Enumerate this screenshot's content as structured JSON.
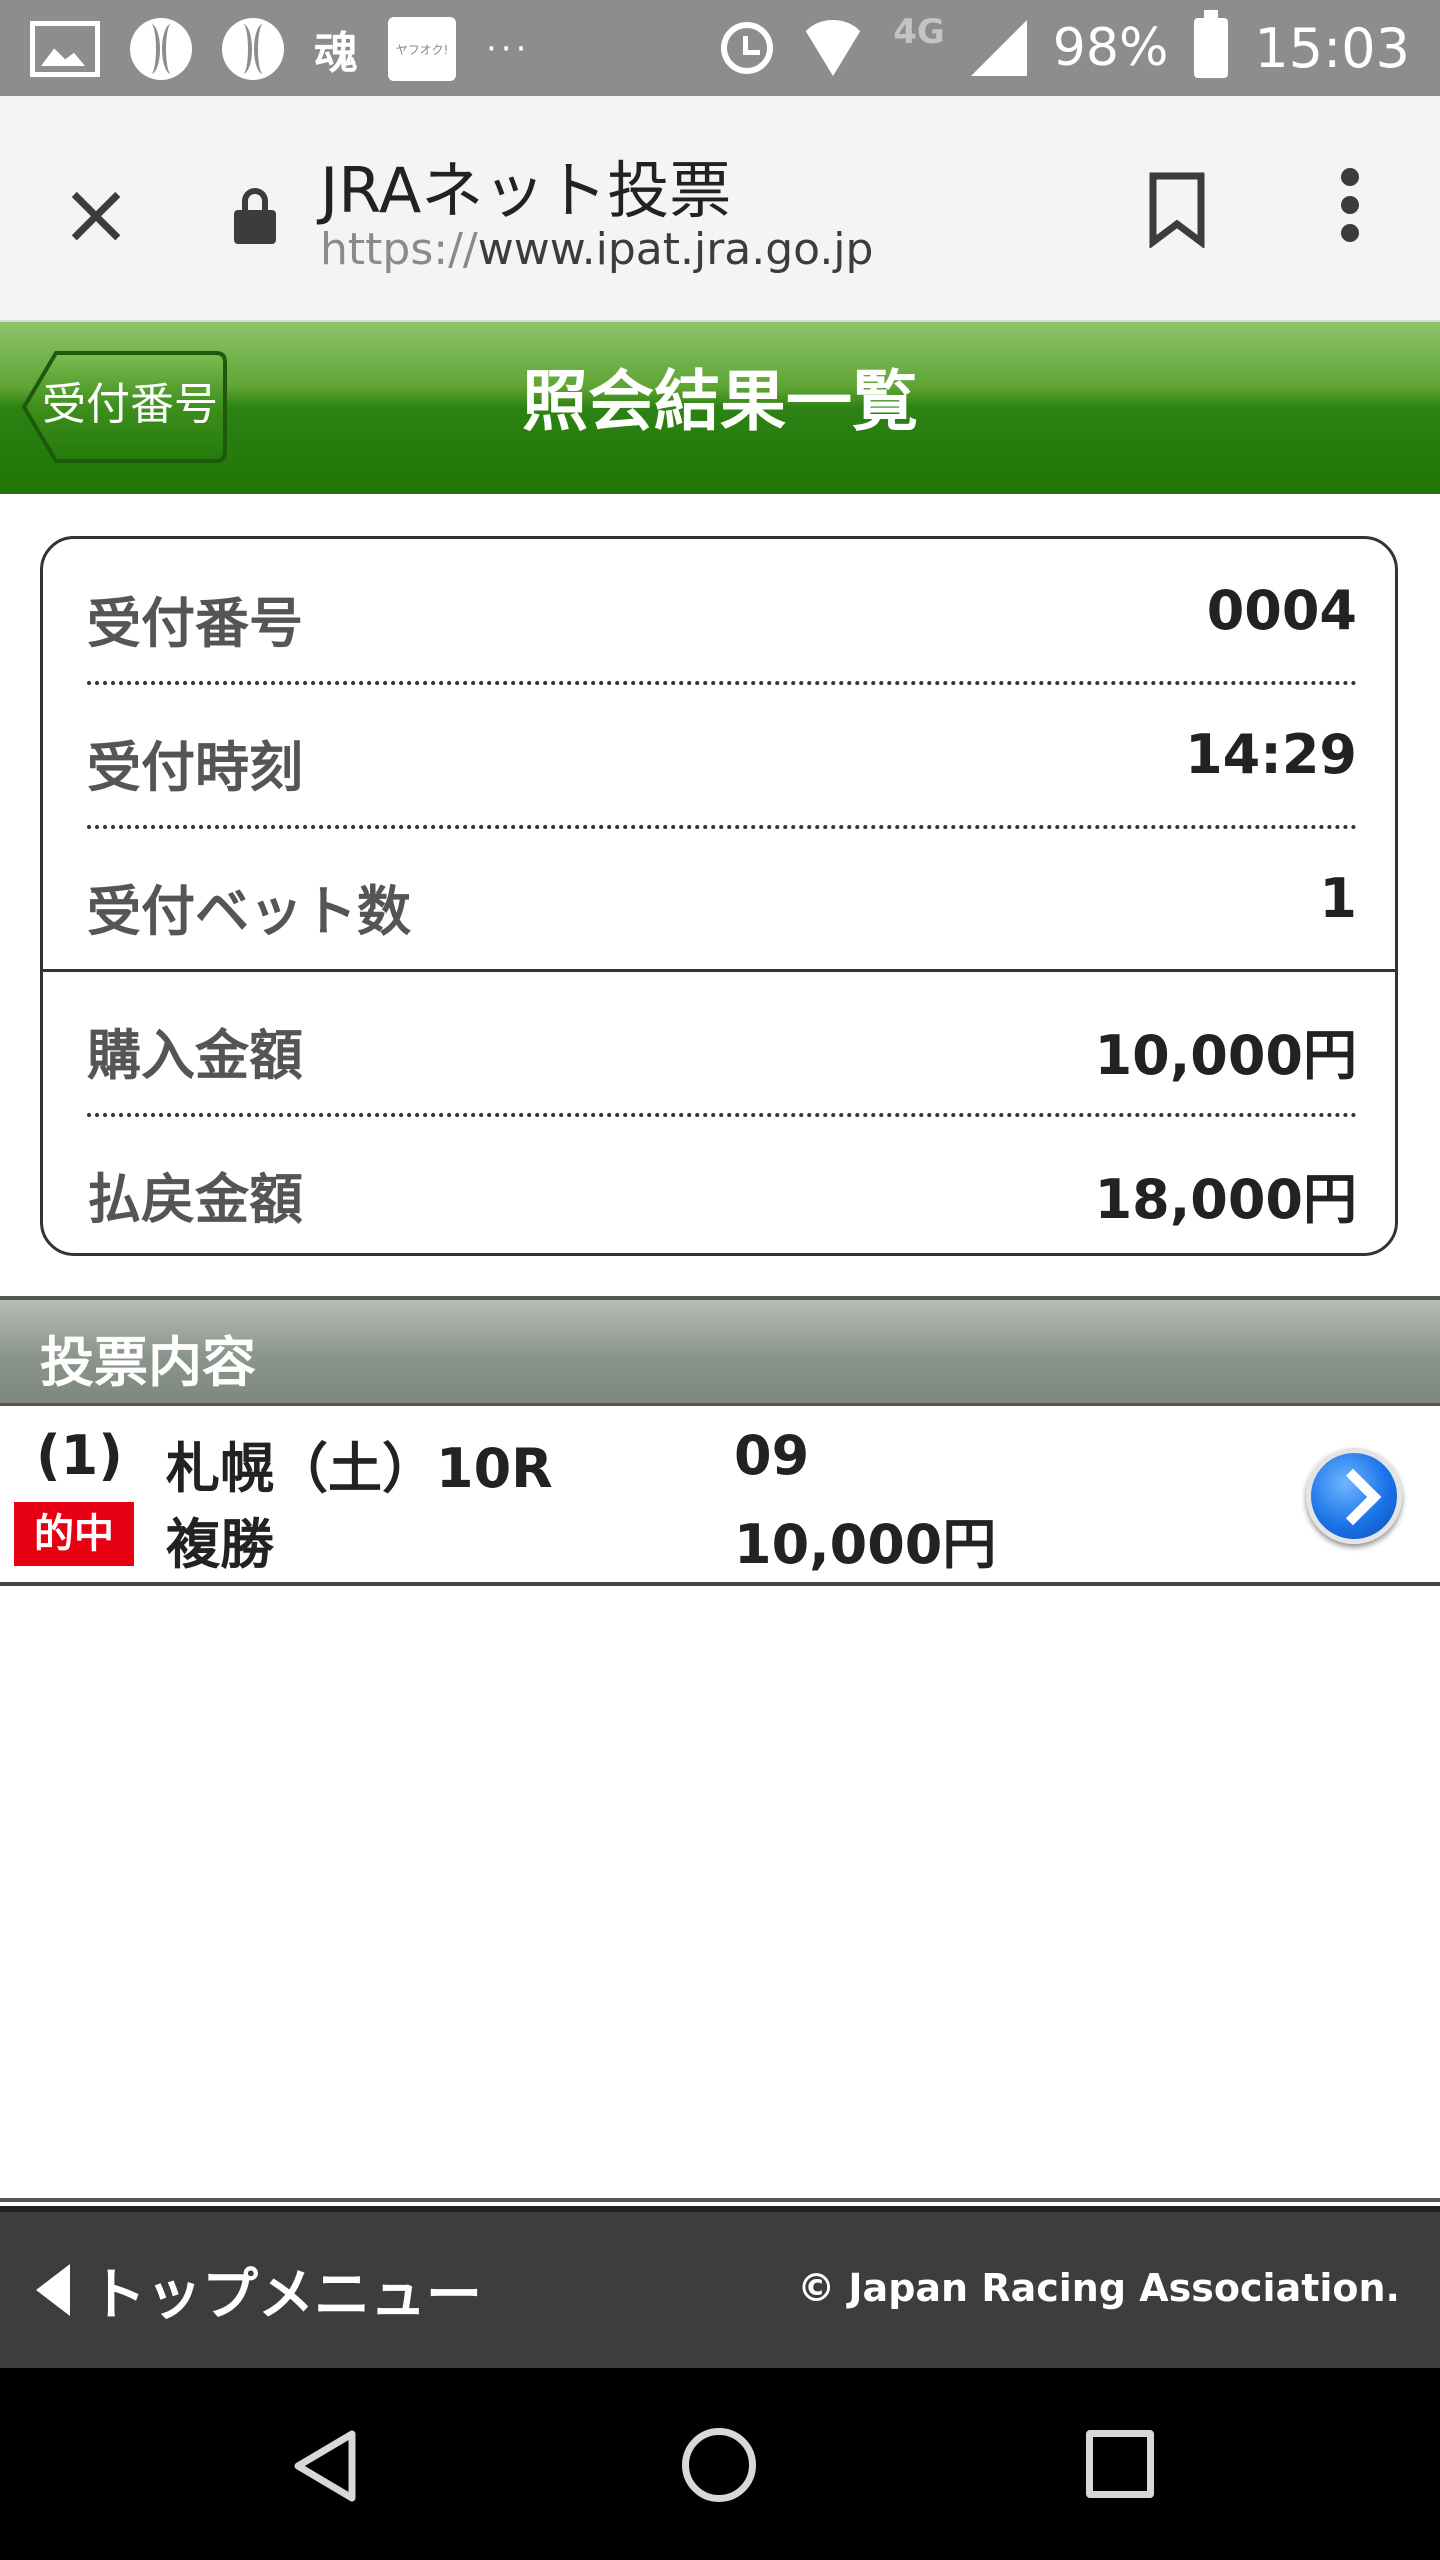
{
  "status_bar": {
    "battery_percent": "98%",
    "time": "15:03",
    "network": "4G",
    "more_dots": "···",
    "notification_icons": [
      "gallery-icon",
      "baseball-icon",
      "baseball-icon",
      "brush-app-icon",
      "yahuoku-app-icon"
    ],
    "app_label_yahuoku": "ヤフオク!"
  },
  "browser": {
    "page_title": "JRAネット投票",
    "url_scheme": "https://",
    "url_host": "www.ipat.jra.go.jp"
  },
  "header": {
    "back_label": "受付番号",
    "title": "照会結果一覧"
  },
  "summary": [
    {
      "label": "受付番号",
      "value": "0004"
    },
    {
      "label": "受付時刻",
      "value": "14:29"
    },
    {
      "label": "受付ベット数",
      "value": "1"
    },
    {
      "label": "購入金額",
      "value": "10,000円"
    },
    {
      "label": "払戻金額",
      "value": "18,000円"
    }
  ],
  "vote_section": {
    "title": "投票内容",
    "bets": [
      {
        "number": "(1)",
        "race": "札幌（土）10R",
        "horse": "09",
        "result_badge": "的中",
        "bet_type": "複勝",
        "amount": "10,000円"
      }
    ]
  },
  "footer": {
    "top_menu_label": "トップメニュー",
    "copyright": "© Japan Racing Association."
  },
  "colors": {
    "header_green": "#2c8212",
    "hit_badge_red": "#e60012",
    "status_bar_gray": "#8d8d8d",
    "footer_dark": "#3d3d3d"
  }
}
